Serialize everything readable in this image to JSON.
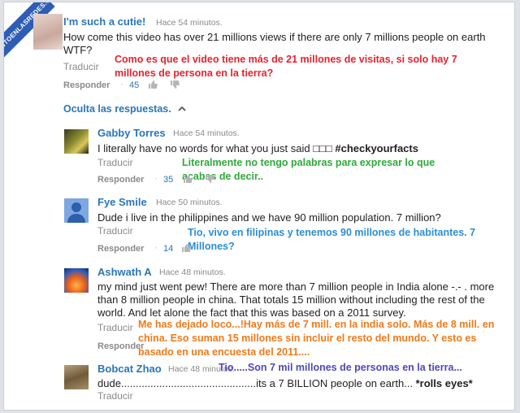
{
  "watermark": "VISTOENLASREDES.COM",
  "comments": [
    {
      "author": "I'm such a cutie!",
      "time": "Hace 54 minutos.",
      "text": "How come this video has over 21 millions views if there are only 7 millions people on earth WTF?",
      "translate": "Traducir",
      "reply": "Responder",
      "likes": "45",
      "overlay": "Como es que el video tiene más de 21 millones de visitas, si solo hay 7 millones de persona en la tierra?"
    }
  ],
  "toggle": "Oculta las respuestas.",
  "replies": [
    {
      "author": "Gabby Torres",
      "time": "Hace 54 minutos.",
      "text": "I literally have no words for what you just said □□□ ",
      "hashtag": "#checkyourfacts",
      "translate": "Traducir",
      "reply": "Responder",
      "likes": "35",
      "overlay": "Literalmente no tengo palabras para expresar lo que acabas de decir.."
    },
    {
      "author": "Fye Smile",
      "time": "Hace 50 minutos.",
      "text": "Dude i live in the philippines and we have 90 million population. 7 million?",
      "translate": "Traducir",
      "reply": "Responder",
      "likes": "14",
      "overlay": "Tio, vivo en filipinas y tenemos 90 millones de habitantes. 7 Millones?"
    },
    {
      "author": "Ashwath A",
      "time": "Hace 48 minutos.",
      "text": "my mind just went pew! There are more than 7 million people in India alone -.- . more than 8 million people in china. That totals 15 million without including the rest of the world. And let alone the fact that this was based on a 2011 survey.",
      "translate": "Traducir",
      "reply": "Responder",
      "overlay": "Me has dejado loco...!Hay más de 7 mill. en la india solo. Más de 8 mill. en china. Eso suman 15 millones sin incluir el resto del mundo. Y esto es basado en una encuesta del 2011...."
    },
    {
      "author": "Bobcat Zhao",
      "time": "Hace 48 minutos.",
      "text": "dude..............................................its a 7 BILLION people on earth... ",
      "emphasis": "*rolls eyes*",
      "translate": "Traducir",
      "overlay": "Tio.....Son 7 mil millones de personas en la tierra..."
    }
  ],
  "colors": {
    "link": "#2a76b8",
    "red_caption": "#e8222e",
    "green_caption": "#2eaa3a",
    "blue_caption": "#2a8fd0",
    "orange_caption": "#f07a1a",
    "purple_caption": "#5048b8"
  }
}
